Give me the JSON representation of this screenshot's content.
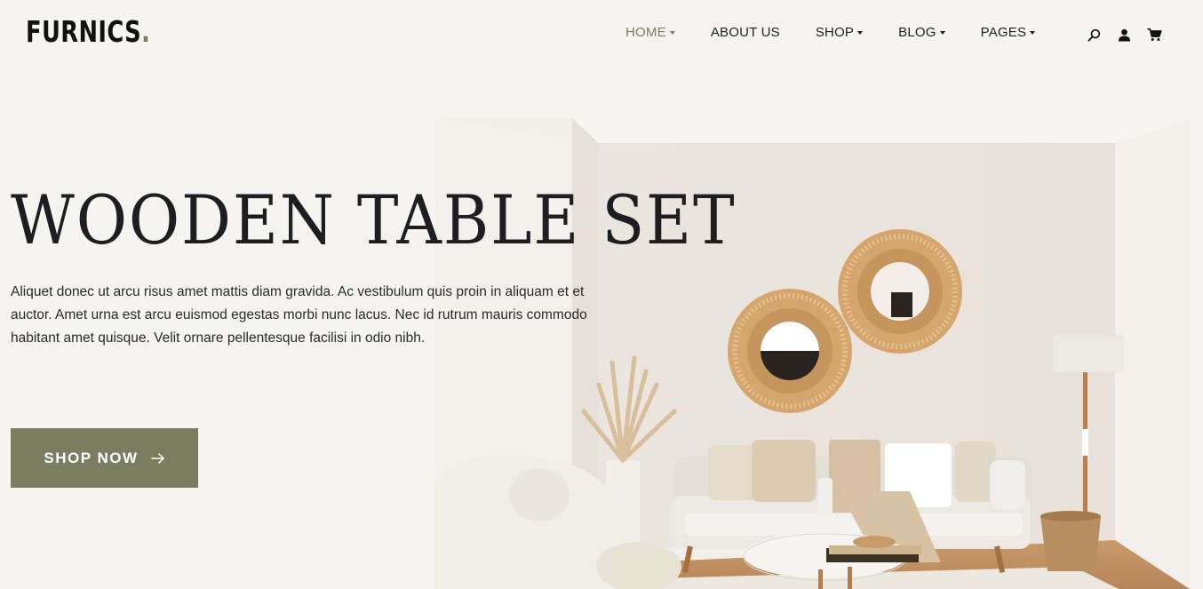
{
  "brand": {
    "name": "FURNICS",
    "dot": "."
  },
  "nav": {
    "items": [
      {
        "label": "HOME",
        "dropdown": true,
        "active": true
      },
      {
        "label": "ABOUT US",
        "dropdown": false,
        "active": false
      },
      {
        "label": "SHOP",
        "dropdown": true,
        "active": false
      },
      {
        "label": "BLOG",
        "dropdown": true,
        "active": false
      },
      {
        "label": "PAGES",
        "dropdown": true,
        "active": false
      }
    ],
    "icons": [
      "search-icon",
      "user-icon",
      "cart-icon"
    ]
  },
  "hero": {
    "title": "WOODEN TABLE SET",
    "description": "Aliquet donec ut arcu risus amet mattis diam gravida. Ac vestibulum quis proin in aliquam et et auctor. Amet urna est arcu euismod egestas morbi nunc lacus. Nec id rutrum mauris commodo habitant amet quisque. Velit ornare pellentesque facilisi in odio nibh.",
    "cta_label": "SHOP NOW"
  },
  "colors": {
    "accent": "#7b7d61",
    "background": "#f5f4f0",
    "text": "#1e1e22"
  }
}
